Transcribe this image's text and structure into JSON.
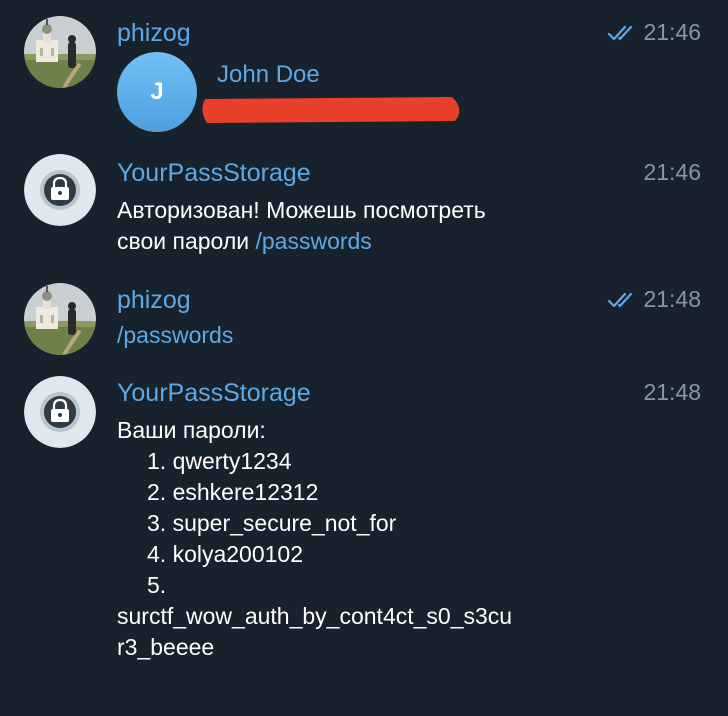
{
  "colors": {
    "background": "#18222d",
    "accent": "#5fa8e8",
    "muted": "#8496a8",
    "text": "#ffffff",
    "redaction": "#e8402a"
  },
  "messages": [
    {
      "sender": "phizog",
      "time": "21:46",
      "avatar_icon": "church-photo-avatar",
      "read_ticks": "double-check-icon",
      "contact": {
        "initial": "J",
        "name": "John Doe"
      }
    },
    {
      "sender": "YourPassStorage",
      "time": "21:46",
      "avatar_icon": "lock-bot-avatar",
      "text_line1": "Авторизован! Можешь посмотреть",
      "text_line2_prefix": "свои пароли ",
      "text_line2_link": "/passwords"
    },
    {
      "sender": "phizog",
      "time": "21:48",
      "avatar_icon": "church-photo-avatar",
      "read_ticks": "double-check-icon",
      "link_text": "/passwords"
    },
    {
      "sender": "YourPassStorage",
      "time": "21:48",
      "avatar_icon": "lock-bot-avatar",
      "heading": "Ваши пароли:",
      "items": [
        "1. qwerty1234",
        "2. eshkere12312",
        "3. super_secure_not_for",
        "4. kolya200102",
        "5."
      ],
      "wrap_line1": "surctf_wow_auth_by_cont4ct_s0_s3cu",
      "wrap_line2": "r3_beeee"
    }
  ]
}
